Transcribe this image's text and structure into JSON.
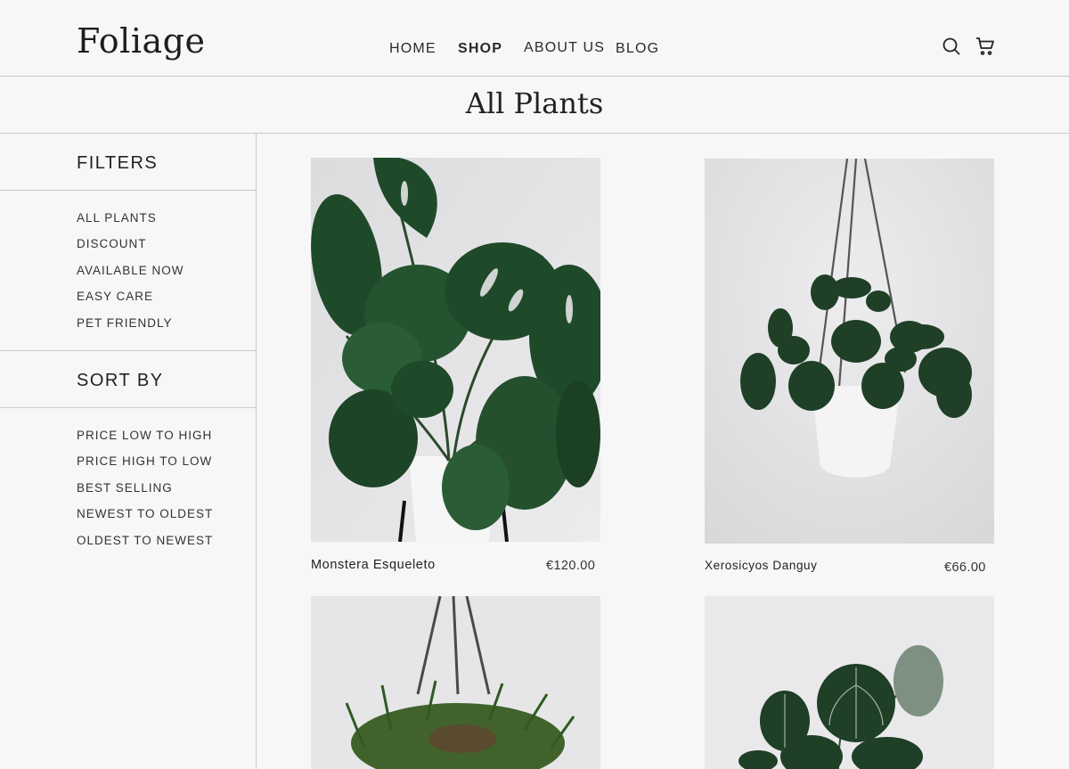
{
  "brand": {
    "name": "Foliage"
  },
  "nav": [
    {
      "label": "HOME",
      "active": false
    },
    {
      "label": "SHOP",
      "active": true
    },
    {
      "label": "ABOUT US",
      "active": false
    },
    {
      "label": "BLOG",
      "active": false
    }
  ],
  "icons": {
    "search": "search-icon",
    "cart": "cart-icon"
  },
  "page": {
    "title": "All Plants"
  },
  "filters": {
    "heading": "FILTERS",
    "items": [
      "ALL PLANTS",
      "DISCOUNT",
      "AVAILABLE NOW",
      "EASY CARE",
      "PET FRIENDLY"
    ]
  },
  "sort": {
    "heading": "SORT BY",
    "items": [
      "PRICE LOW TO HIGH",
      "PRICE HIGH TO LOW",
      "BEST SELLING",
      "NEWEST TO OLDEST",
      "OLDEST TO NEWEST"
    ]
  },
  "products": [
    {
      "name": "Monstera Esqueleto",
      "price": "€120.00"
    },
    {
      "name": "Xerosicyos Danguy",
      "price": "€66.00"
    },
    {
      "name": "",
      "price": ""
    },
    {
      "name": "",
      "price": ""
    }
  ],
  "colors": {
    "background": "#f7f7f8",
    "text": "#222222",
    "divider": "#c9c9cc",
    "leaf": "#1f4a2a"
  }
}
